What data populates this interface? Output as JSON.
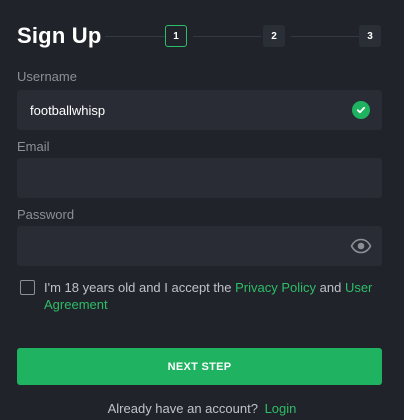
{
  "header": {
    "title": "Sign Up",
    "steps": [
      "1",
      "2",
      "3"
    ],
    "active_step": "1"
  },
  "form": {
    "username": {
      "label": "Username",
      "value": "footballwhisp",
      "status_icon": "check-circle-icon"
    },
    "email": {
      "label": "Email",
      "value": ""
    },
    "password": {
      "label": "Password",
      "value": "",
      "toggle_icon": "eye-icon"
    }
  },
  "terms": {
    "prefix": "I'm 18 years old and I accept the ",
    "privacy_link": "Privacy Policy",
    "conjunction": " and ",
    "agreement_link": "User Agreement",
    "checked": false
  },
  "actions": {
    "next_label": "NEXT STEP"
  },
  "footer": {
    "prompt": "Already have an account?",
    "login_link": "Login"
  },
  "colors": {
    "background": "#20232a",
    "field_background": "#292c34",
    "accent": "#1fb361",
    "muted_text": "#8c8f96"
  }
}
